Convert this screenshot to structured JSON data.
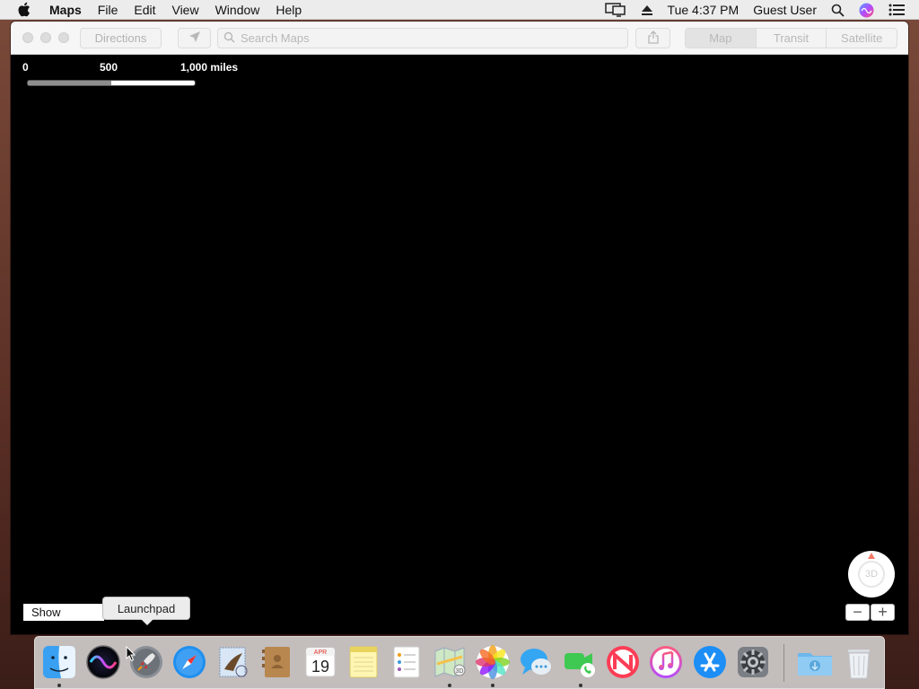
{
  "menubar": {
    "app_name": "Maps",
    "items": [
      "File",
      "Edit",
      "View",
      "Window",
      "Help"
    ],
    "clock": "Tue 4:37 PM",
    "user": "Guest User"
  },
  "toolbar": {
    "directions_label": "Directions",
    "search_placeholder": "Search Maps",
    "segments": [
      "Map",
      "Transit",
      "Satellite"
    ],
    "selected_segment": "Map"
  },
  "map": {
    "scale": {
      "labels": [
        "0",
        "500",
        "1,000 miles"
      ]
    },
    "compass_label": "3D",
    "zoom_out_label": "−",
    "zoom_in_label": "+",
    "show_label": "Show"
  },
  "tooltip": {
    "text": "Launchpad"
  },
  "dock": {
    "apps": [
      {
        "name": "Finder",
        "running": true
      },
      {
        "name": "Siri",
        "running": false
      },
      {
        "name": "Launchpad",
        "running": false
      },
      {
        "name": "Safari",
        "running": false
      },
      {
        "name": "Mail",
        "running": false
      },
      {
        "name": "Contacts",
        "running": false
      },
      {
        "name": "Calendar",
        "running": false,
        "month": "APR",
        "day": "19"
      },
      {
        "name": "Notes",
        "running": false
      },
      {
        "name": "Reminders",
        "running": false
      },
      {
        "name": "Maps",
        "running": true
      },
      {
        "name": "Photos",
        "running": true
      },
      {
        "name": "Messages",
        "running": false
      },
      {
        "name": "FaceTime",
        "running": true
      },
      {
        "name": "News",
        "running": false
      },
      {
        "name": "iTunes",
        "running": false
      },
      {
        "name": "App Store",
        "running": false
      },
      {
        "name": "System Preferences",
        "running": false
      },
      {
        "name": "Downloads",
        "running": false
      },
      {
        "name": "Trash",
        "running": false
      }
    ]
  },
  "colors": {
    "menubar_bg": "#ececec",
    "map_bg": "#000000",
    "toolbar_bg": "#f6f6f6"
  }
}
